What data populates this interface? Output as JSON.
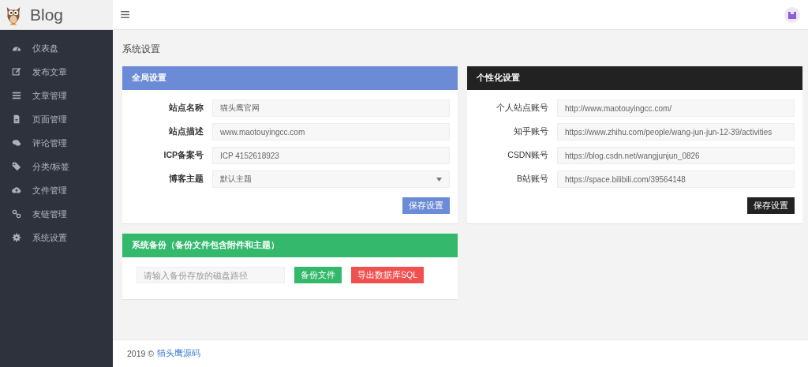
{
  "brand": {
    "title": "Blog"
  },
  "sidebar": {
    "items": [
      {
        "label": "仪表盘",
        "kind": "dashboard"
      },
      {
        "label": "发布文章",
        "kind": "edit"
      },
      {
        "label": "文章管理",
        "kind": "list"
      },
      {
        "label": "页面管理",
        "kind": "file"
      },
      {
        "label": "评论管理",
        "kind": "comments"
      },
      {
        "label": "分类/标签",
        "kind": "tag"
      },
      {
        "label": "文件管理",
        "kind": "cloud"
      },
      {
        "label": "友链管理",
        "kind": "link"
      },
      {
        "label": "系统设置",
        "kind": "gear"
      }
    ]
  },
  "page_title": "系统设置",
  "panels": [
    {
      "title": "全局设置",
      "kind": "blue",
      "fields": [
        {
          "label": "站点名称",
          "value": "猫头鹰官网",
          "kind": "input"
        },
        {
          "label": "站点描述",
          "value": "www.maotouyingcc.com",
          "kind": "input"
        },
        {
          "label": "ICP备案号",
          "value": "ICP 4152618923",
          "kind": "input"
        },
        {
          "label": "博客主题",
          "value": "默认主题",
          "kind": "select"
        }
      ],
      "save_button": "保存设置"
    },
    {
      "title": "个性化设置",
      "kind": "dark",
      "fields": [
        {
          "label": "个人站点账号",
          "value": "http://www.maotouyingcc.com/",
          "kind": "input"
        },
        {
          "label": "知乎账号",
          "value": "https://www.zhihu.com/people/wang-jun-jun-12-39/activities",
          "kind": "input"
        },
        {
          "label": "CSDN账号",
          "value": "https://blog.csdn.net/wangjunjun_0826",
          "kind": "input"
        },
        {
          "label": "B站账号",
          "value": "https://space.bilibili.com/39564148",
          "kind": "input"
        }
      ],
      "save_button": "保存设置"
    }
  ],
  "backup": {
    "title": "系统备份（备份文件包含附件和主题）",
    "path_field": {
      "placeholder": "请输入备份存放的磁盘路径"
    },
    "buttons": [
      {
        "label": "备份文件",
        "kind": "backup"
      },
      {
        "label": "导出数据库SQL",
        "kind": "export"
      }
    ]
  },
  "footer": {
    "copyright": "2019 ©",
    "link": "猫头鹰源码"
  }
}
